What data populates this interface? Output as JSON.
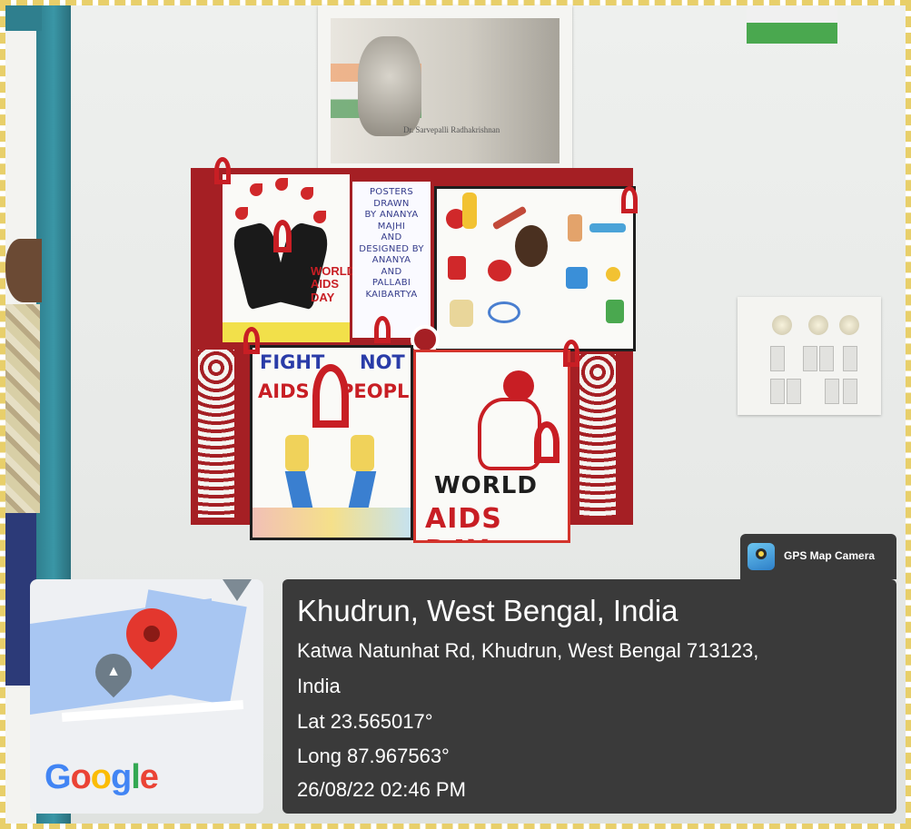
{
  "portrait": {
    "caption": "Dr. Sarvepalli Radhakrishnan"
  },
  "posters": {
    "credits": [
      "POSTERS",
      "DRAWN",
      "BY ANANYA MAJHI",
      "AND",
      "DESIGNED BY",
      "ANANYA",
      "AND",
      "PALLABI",
      "KAIBARTYA"
    ],
    "hands_text": [
      "WORLD",
      "AIDS",
      "DAY"
    ],
    "fight_line1_left": "FIGHT",
    "fight_line1_right": "NOT",
    "fight_line2_left": "AIDS",
    "fight_line2_right": "PEOPLE",
    "world_title": "WORLD",
    "world_sub": "AIDS DAY"
  },
  "gps_badge": {
    "label": "GPS Map Camera",
    "icon": "gps-map-camera-icon"
  },
  "map": {
    "brand": [
      "G",
      "o",
      "o",
      "g",
      "l",
      "e"
    ],
    "pin_icon": "location-pin-icon",
    "poi_icon": "school-icon"
  },
  "location": {
    "title": "Khudrun, West Bengal, India",
    "address_line1": "Katwa Natunhat Rd, Khudrun, West Bengal 713123,",
    "address_line2": "India",
    "lat": "Lat 23.565017°",
    "long": "Long 87.967563°",
    "datetime": "26/08/22 02:46 PM"
  },
  "colors": {
    "board_red": "#a51f24",
    "overlay_bg": "#3a3a3a",
    "pin_red": "#e3372e",
    "door_teal": "#2f7f8e"
  }
}
